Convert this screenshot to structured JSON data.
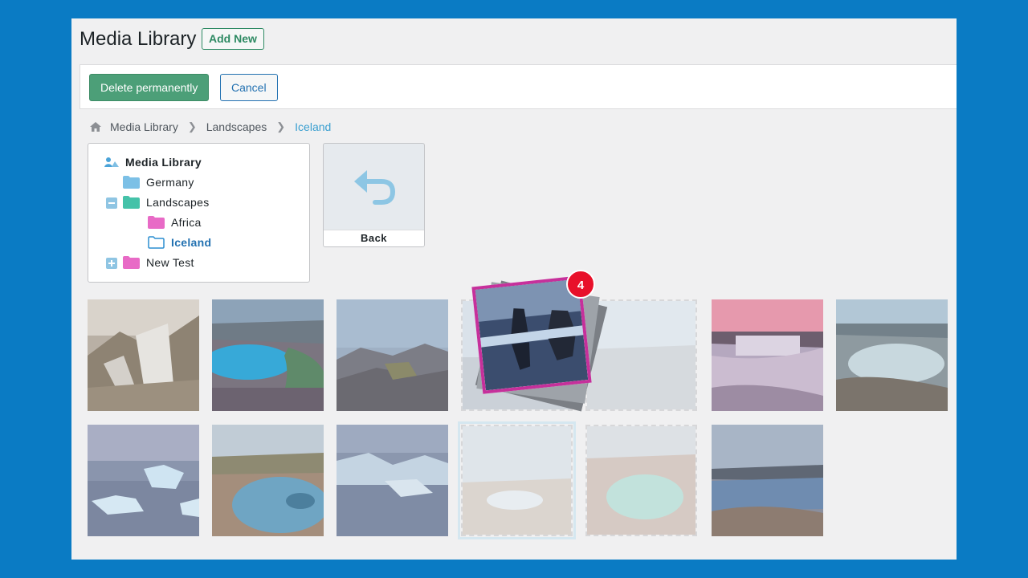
{
  "header": {
    "title": "Media Library",
    "add_new": "Add New"
  },
  "bulk_actions": {
    "delete": "Delete permanently",
    "cancel": "Cancel"
  },
  "breadcrumb": {
    "items": [
      "Media Library",
      "Landscapes",
      "Iceland"
    ]
  },
  "tree": {
    "items": [
      {
        "label": "Media Library",
        "icon": "media-library-icon"
      },
      {
        "label": "Germany",
        "icon": "folder-blue-icon"
      },
      {
        "label": "Landscapes",
        "icon": "folder-teal-icon",
        "toggle": "collapse-icon"
      },
      {
        "label": "Africa",
        "icon": "folder-pink-icon"
      },
      {
        "label": "Iceland",
        "icon": "folder-outline-icon",
        "active": true
      },
      {
        "label": "New Test",
        "icon": "folder-pink-icon",
        "toggle": "expand-icon"
      }
    ]
  },
  "back_tile": {
    "label": "Back",
    "icon": "undo-arrow-icon"
  },
  "drag": {
    "count": "4"
  },
  "colors": {
    "background": "#0a7bc4",
    "primary_button": "#4c9f78",
    "link": "#2271b1",
    "breadcrumb_current": "#3a9fd0",
    "badge": "#e8102a",
    "drag_border": "#c6309b"
  }
}
